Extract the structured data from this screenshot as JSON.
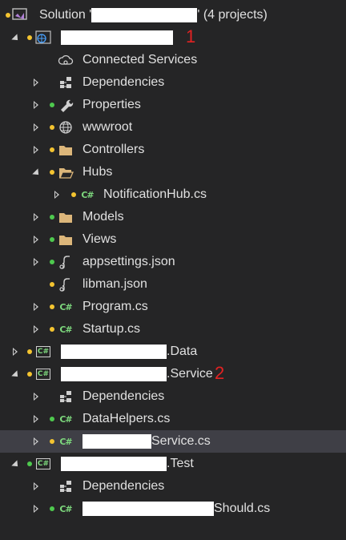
{
  "solution": {
    "prefix": "Solution '",
    "suffix": "' (4 projects)"
  },
  "markers": {
    "one": "1",
    "two": "2"
  },
  "web_project": {
    "connected_services": "Connected Services",
    "dependencies": "Dependencies",
    "properties": "Properties",
    "wwwroot": "wwwroot",
    "controllers": "Controllers",
    "hubs": "Hubs",
    "notification_hub": "NotificationHub.cs",
    "models": "Models",
    "views": "Views",
    "appsettings": "appsettings.json",
    "libman": "libman.json",
    "program": "Program.cs",
    "startup": "Startup.cs"
  },
  "data_project": {
    "suffix": ".Data"
  },
  "service_project": {
    "suffix": ".Service",
    "dependencies": "Dependencies",
    "datahelpers": "DataHelpers.cs",
    "service_file_suffix": "Service.cs"
  },
  "test_project": {
    "suffix": ".Test",
    "dependencies": "Dependencies",
    "test_file_suffix": "Should.cs"
  },
  "colors": {
    "background": "#252526",
    "selected_row": "#3f3f46",
    "text": "#e0e0e0",
    "status_green": "#4ec94e",
    "status_yellow": "#f4c430",
    "csharp_green": "#7dd87d",
    "folder": "#dcb67a",
    "marker_red": "#e32222"
  }
}
